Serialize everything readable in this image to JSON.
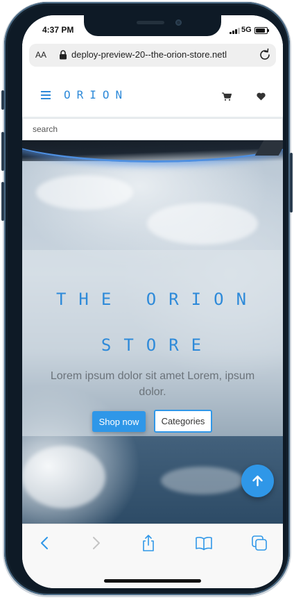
{
  "status_bar": {
    "time": "4:37 PM",
    "network": "5G"
  },
  "browser": {
    "text_size_label": "AA",
    "url": "deploy-preview-20--the-orion-store.netl"
  },
  "site": {
    "brand": "ORION",
    "search_placeholder": "search"
  },
  "hero": {
    "title": "THE ORION STORE",
    "text": "Lorem ipsum dolor sit amet Lorem, ipsum dolor.",
    "shop_button": "Shop now",
    "categories_button": "Categories"
  },
  "colors": {
    "accent": "#2e8ad9",
    "button": "#2f97e8",
    "frame": "#0e1a26"
  },
  "icons": [
    "menu-icon",
    "cart-icon",
    "heart-icon",
    "lock-icon",
    "reload-icon",
    "arrow-up-icon",
    "back-icon",
    "forward-icon",
    "share-icon",
    "bookmarks-icon",
    "tabs-icon"
  ]
}
